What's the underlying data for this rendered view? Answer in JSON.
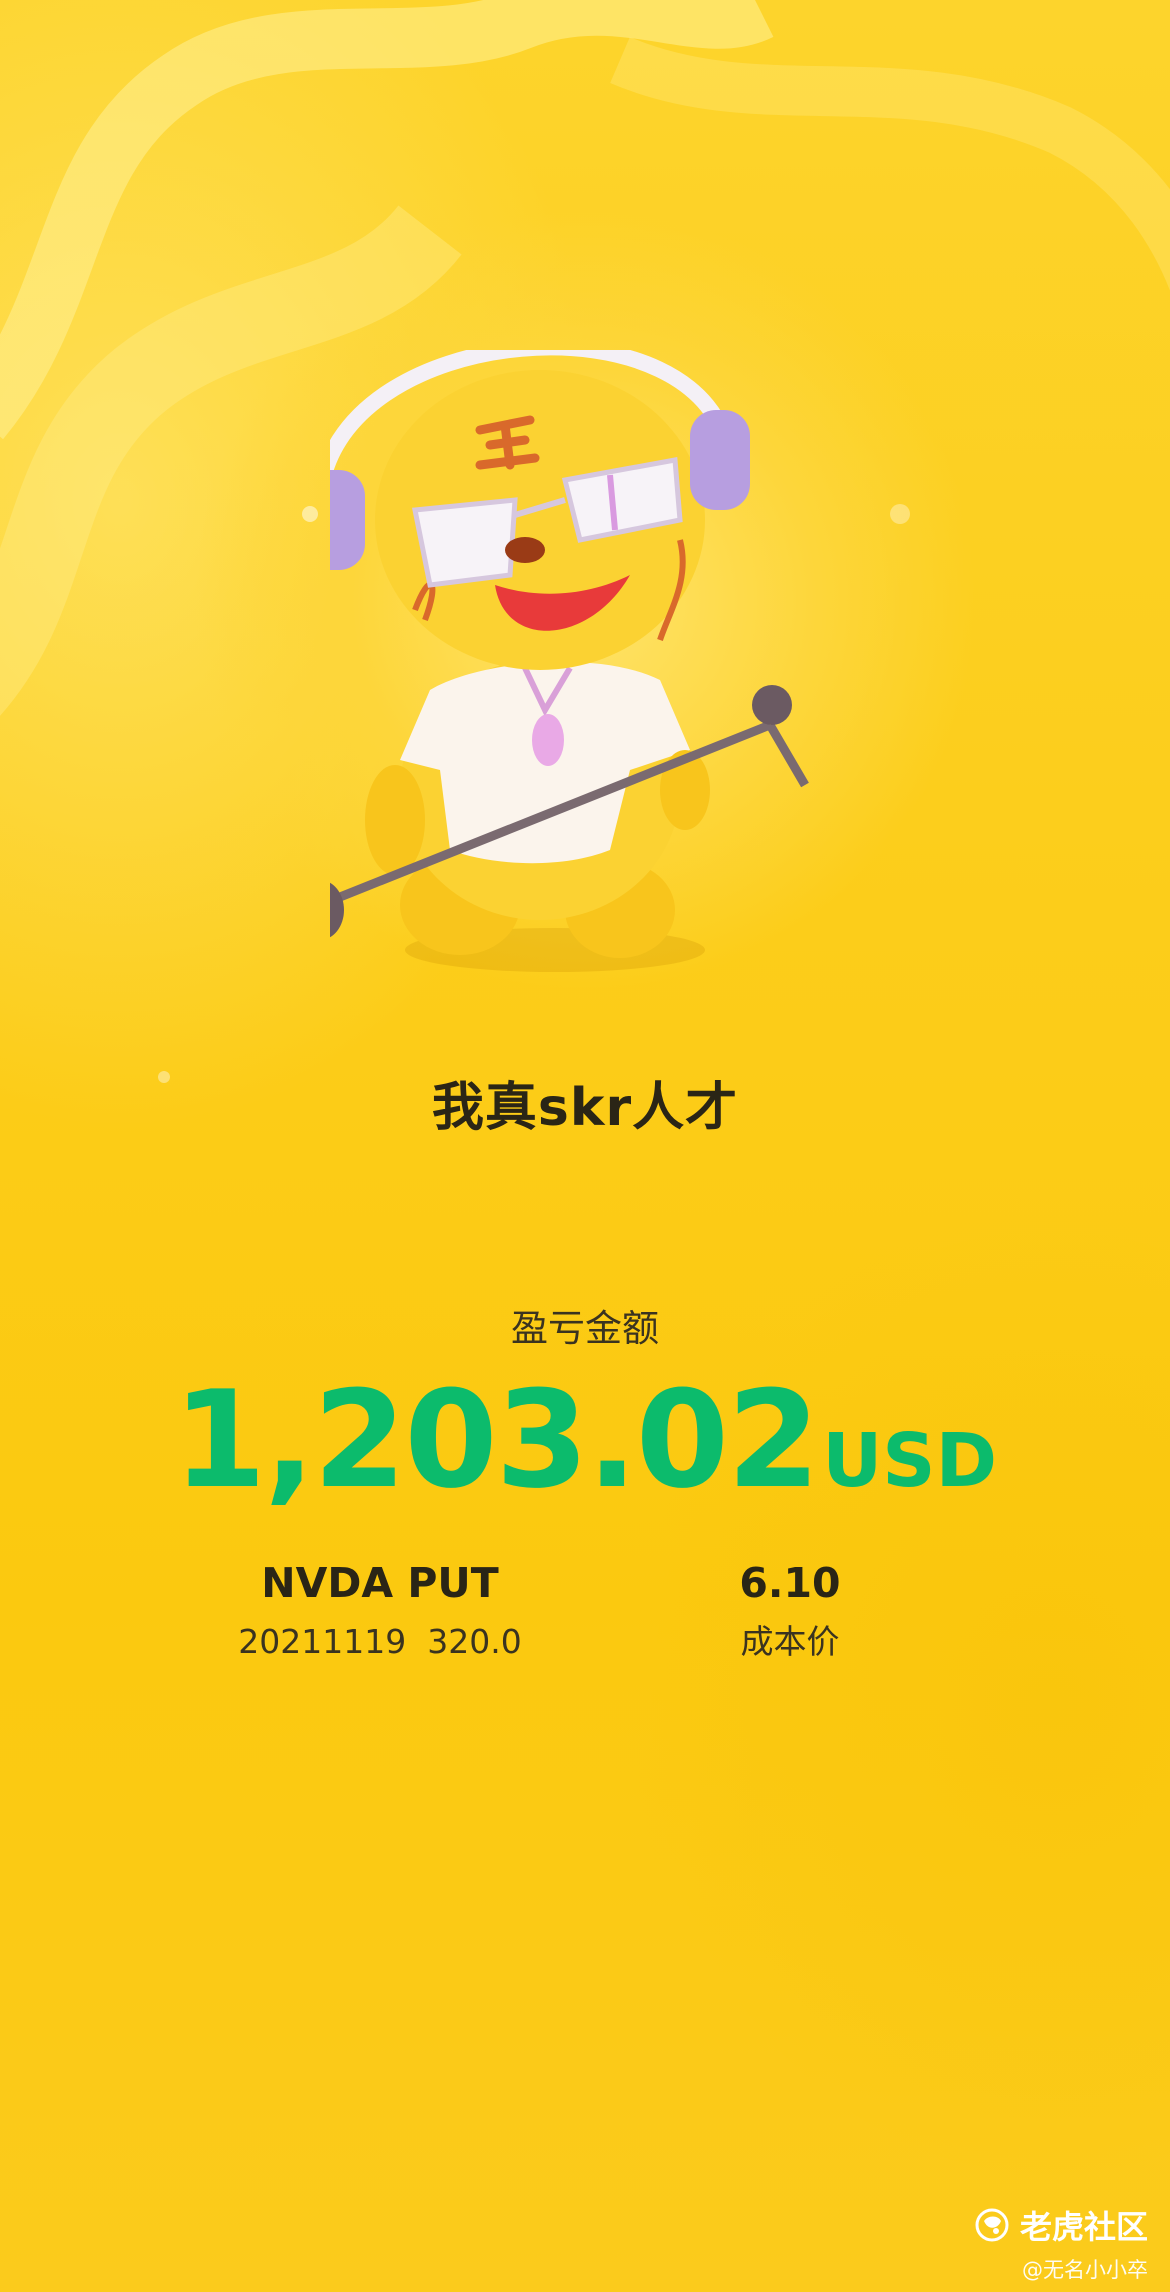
{
  "slogan": "我真skr人才",
  "pnl": {
    "label": "盈亏金额",
    "amount": "1,203.02",
    "currency": "USD"
  },
  "position": {
    "name": "NVDA PUT",
    "detail": "20211119  320.0",
    "price": "6.10",
    "price_label": "成本价"
  },
  "brand": {
    "name": "老虎社区",
    "watermark": "@无名小小卒",
    "icon": "tiger-logo-icon"
  },
  "mascot": {
    "icon": "tiger-mascot-singing"
  },
  "colors": {
    "background": "#fcd01f",
    "amount": "#0cbb6c",
    "text": "#2a2516"
  }
}
